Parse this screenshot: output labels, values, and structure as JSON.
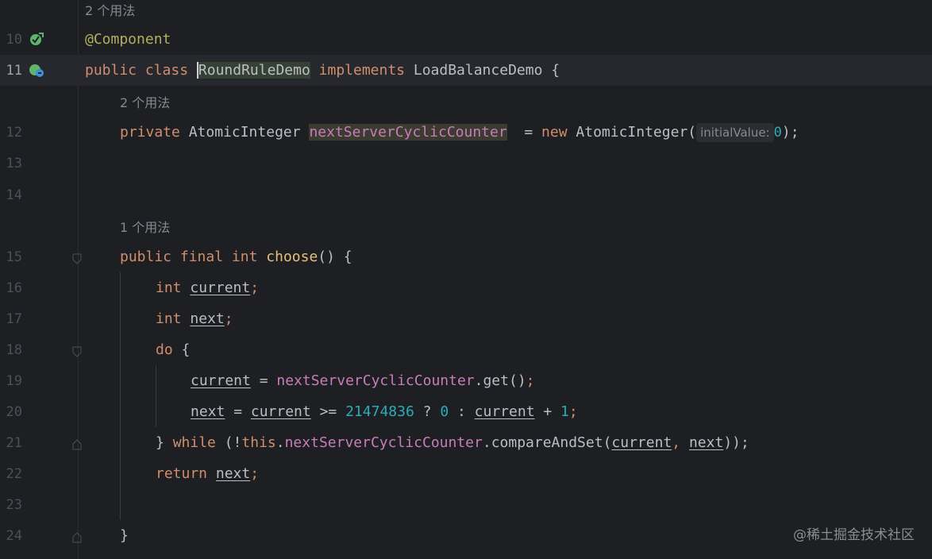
{
  "editor": {
    "watermark": "@稀土掘金技术社区",
    "usage_hints": {
      "class_usage": "2 个用法",
      "field_usage": "2 个用法",
      "method_usage": "1 个用法"
    },
    "line_numbers": [
      "10",
      "11",
      "12",
      "13",
      "14",
      "15",
      "16",
      "17",
      "18",
      "19",
      "20",
      "21",
      "22",
      "23",
      "24"
    ],
    "param_hint": {
      "name": "initialValue:",
      "value": "0"
    },
    "tokens": {
      "annotation": "@Component",
      "public": "public",
      "class": "class",
      "class_name": "RoundRuleDemo",
      "implements": "implements",
      "interface_name": "LoadBalanceDemo",
      "open_brace": " {",
      "private": "private",
      "atomic_integer": "AtomicInteger",
      "field_name": "nextServerCyclicCounter",
      "assign": " = ",
      "new": "new",
      "ctor_open": " AtomicInteger(",
      "ctor_close": ");",
      "final": "final",
      "int": "int",
      "method_name": "choose",
      "method_sig_rest": "() {",
      "current": "current",
      "next": "next",
      "semicolon": ";",
      "do": "do",
      "get_call": "get",
      "parens": "()",
      "dot": ".",
      "gte": " >= ",
      "big_number": "21474836",
      "question": " ? ",
      "zero": "0",
      "colon": " : ",
      "plus": " + ",
      "one": "1",
      "close_brace": "}",
      "while": "while",
      "not_open": " (!",
      "this": "this",
      "compare_and_set": "compareAndSet",
      "comma": ", ",
      "close_parens": "));",
      "return": "return",
      "space": " "
    }
  },
  "colors": {
    "background": "#1e1f22",
    "keyword": "#cf8e6d",
    "annotation": "#b3ae60",
    "field": "#c77dbb",
    "number": "#2aacb8",
    "method_decl": "#e6c07b"
  }
}
